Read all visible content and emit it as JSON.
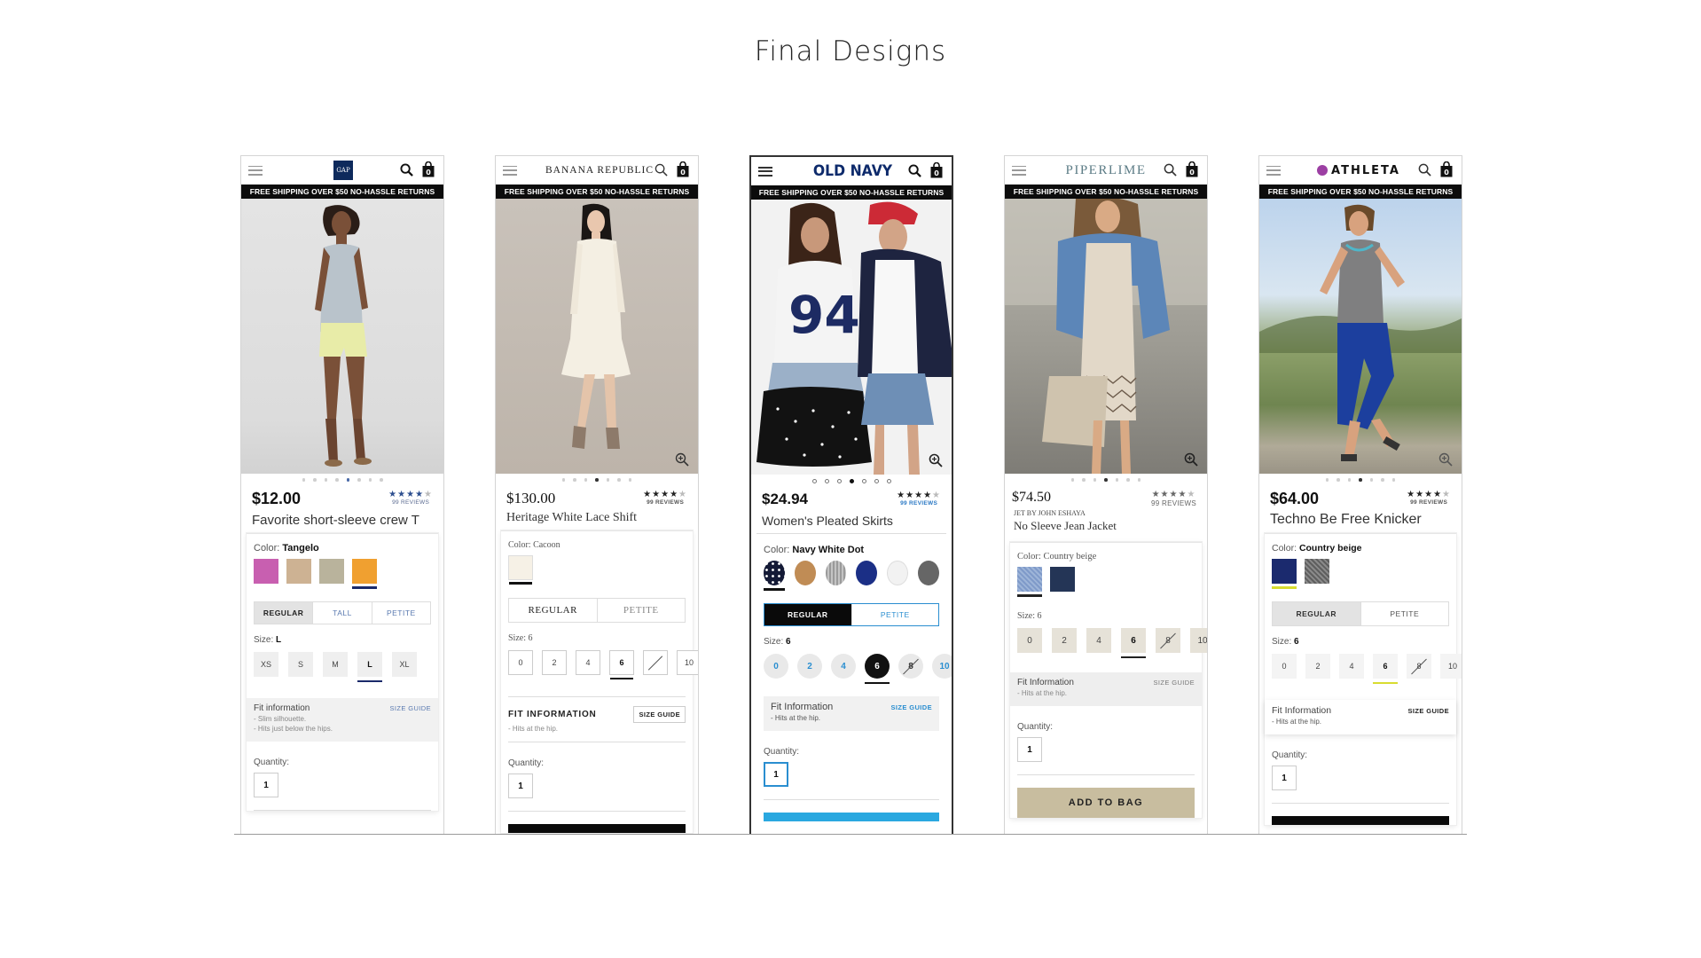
{
  "page": {
    "title": "Final Designs"
  },
  "banner_text": "FREE SHIPPING OVER $50 NO-HASSLE RETURNS",
  "screens": [
    {
      "brand": "GAP",
      "price": "$12.00",
      "reviews": "99 REVIEWS",
      "name": "Favorite short-sleeve crew T",
      "color_label": "Color:",
      "color_value": "Tangelo",
      "swatches": [
        "#c85fb0",
        "#cdb293",
        "#b9b39c",
        "#f0a030"
      ],
      "fits": [
        "REGULAR",
        "TALL",
        "PETITE"
      ],
      "size_label": "Size:",
      "size_value": "L",
      "sizes": [
        "XS",
        "S",
        "M",
        "L",
        "XL"
      ],
      "fit_info_title": "Fit information",
      "size_guide": "SIZE GUIDE",
      "fit_notes": [
        "- Slim silhouette.",
        "- Hits just below the hips."
      ],
      "quantity_label": "Quantity:",
      "quantity": "1"
    },
    {
      "brand": "BANANA REPUBLIC",
      "price": "$130.00",
      "reviews": "99 REVIEWS",
      "name": "Heritage White Lace Shift",
      "color_label": "Color:",
      "color_value": "Cacoon",
      "swatches": [
        "#f6f1e6"
      ],
      "fits": [
        "REGULAR",
        "PETITE"
      ],
      "size_label": "Size:",
      "size_value": "6",
      "sizes": [
        "0",
        "2",
        "4",
        "6",
        "8",
        "10"
      ],
      "fit_info_title": "FIT INFORMATION",
      "size_guide": "SIZE GUIDE",
      "fit_notes": [
        "- Hits at the hip."
      ],
      "quantity_label": "Quantity:",
      "quantity": "1"
    },
    {
      "brand": "OLD NAVY",
      "price": "$24.94",
      "reviews": "99 REVIEWS",
      "name": "Women's Pleated Skirts",
      "color_label": "Color:",
      "color_value": "Navy White Dot",
      "swatches": [
        "#141a36",
        "#c08c55",
        "#a8a8a8",
        "#1b2f86",
        "#f2f2f2",
        "#666666"
      ],
      "fits": [
        "REGULAR",
        "PETITE"
      ],
      "size_label": "Size:",
      "size_value": "6",
      "sizes": [
        "0",
        "2",
        "4",
        "6",
        "8",
        "10"
      ],
      "fit_info_title": "Fit Information",
      "size_guide": "SIZE GUIDE",
      "fit_notes": [
        "- Hits at the hip."
      ],
      "quantity_label": "Quantity:",
      "quantity": "1"
    },
    {
      "brand": "PIPERLIME",
      "price": "$74.50",
      "reviews": "99 REVIEWS",
      "designer": "JET BY JOHN ESHAYA",
      "name": "No Sleeve Jean Jacket",
      "color_label": "Color:",
      "color_value": "Country beige",
      "swatches": [
        "#7f9ac9",
        "#243556"
      ],
      "size_label": "Size:",
      "size_value": "6",
      "sizes": [
        "0",
        "2",
        "4",
        "6",
        "8",
        "10"
      ],
      "fit_info_title": "Fit Information",
      "size_guide": "SIZE GUIDE",
      "fit_notes": [
        "- Hits at the hip."
      ],
      "quantity_label": "Quantity:",
      "quantity": "1",
      "cta": "ADD TO BAG"
    },
    {
      "brand": "ATHLETA",
      "price": "$64.00",
      "reviews": "99 REVIEWS",
      "name": "Techno Be Free Knicker",
      "color_label": "Color:",
      "color_value": "Country beige",
      "swatches": [
        "#1b2a6e",
        "#6d6d6d"
      ],
      "fits": [
        "REGULAR",
        "PETITE"
      ],
      "size_label": "Size:",
      "size_value": "6",
      "sizes": [
        "0",
        "2",
        "4",
        "6",
        "8",
        "10"
      ],
      "fit_info_title": "Fit Information",
      "size_guide": "SIZE GUIDE",
      "fit_notes": [
        "- Hits at the hip."
      ],
      "quantity_label": "Quantity:",
      "quantity": "1"
    }
  ],
  "colors": {
    "gap_navy": "#0e2a5c",
    "oldnavy_blue": "#2a8ed0",
    "athleta_purple": "#9c3fa3",
    "piperlime_tan": "#c8bd9f"
  }
}
